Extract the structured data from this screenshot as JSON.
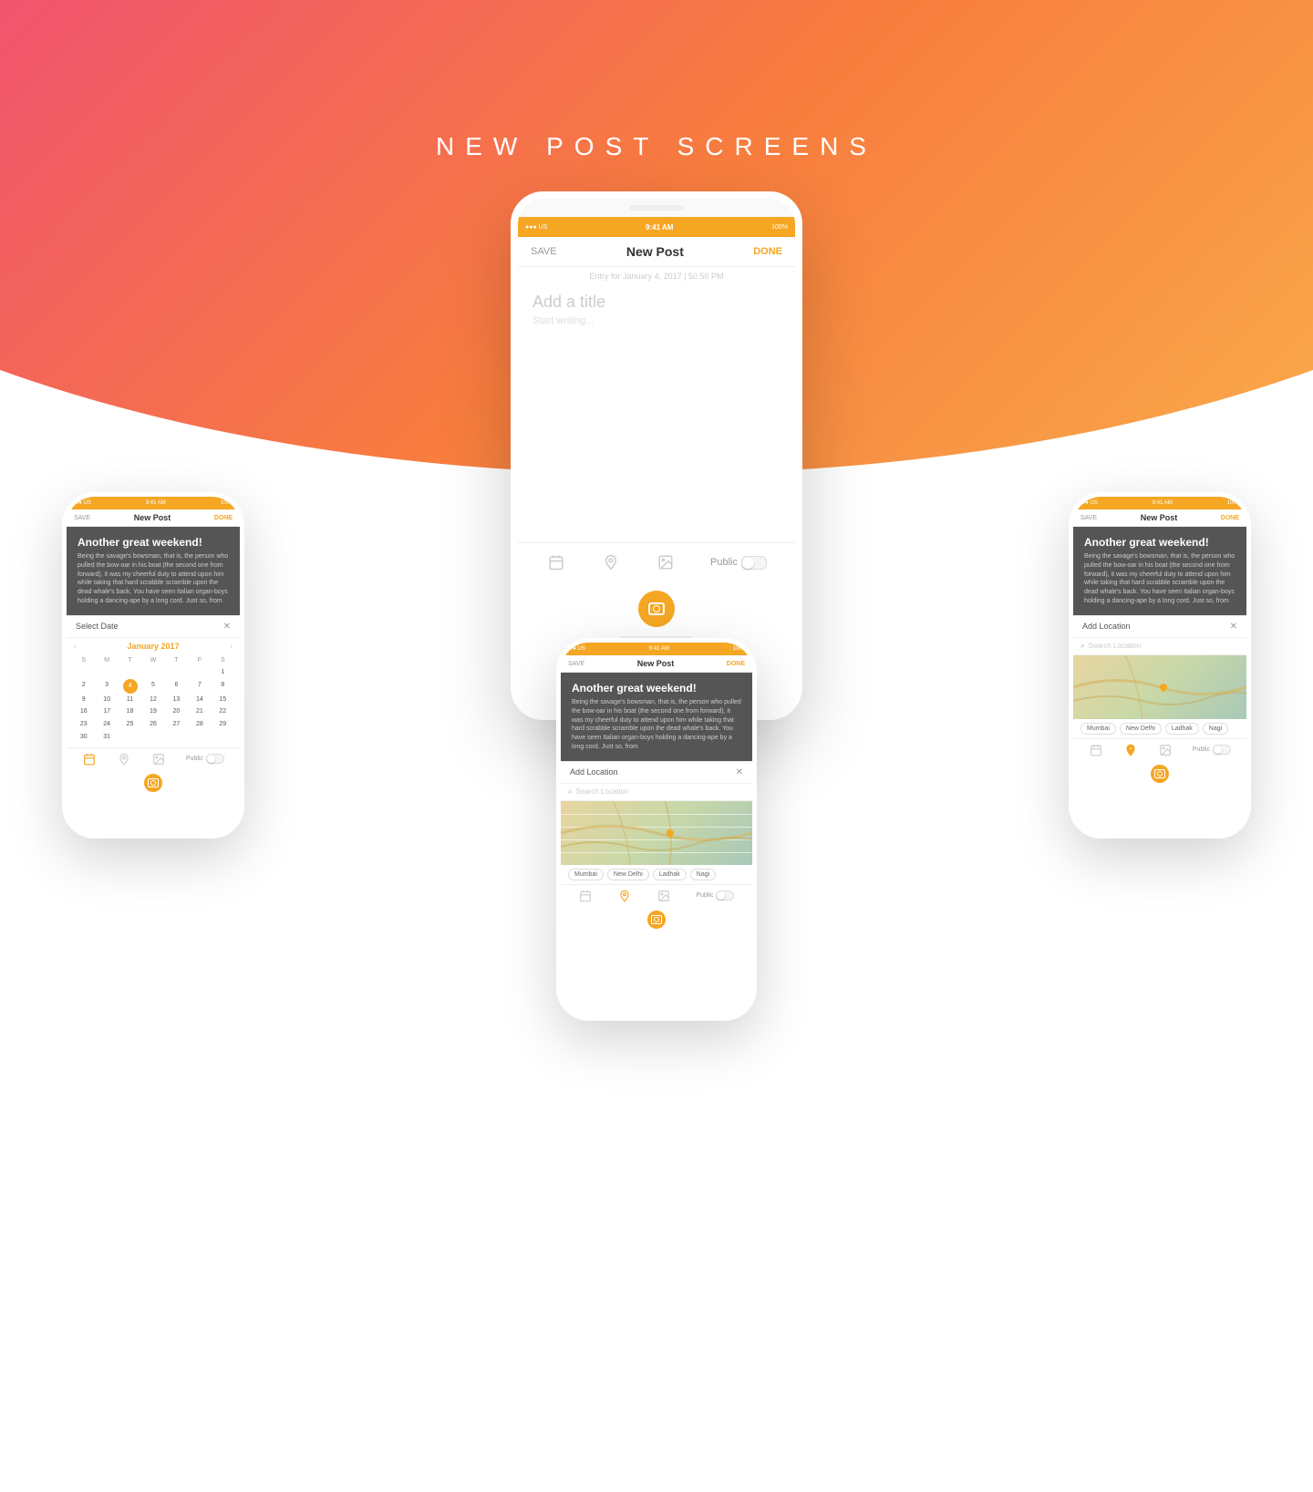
{
  "page": {
    "title": "NEW POST SCREENS",
    "background_gradient_start": "#f0546e",
    "background_gradient_end": "#f9a94a"
  },
  "phones": {
    "center_large": {
      "status": {
        "carrier": "●●● US",
        "wifi": "▾",
        "time": "9:41 AM",
        "battery": "100%"
      },
      "nav": {
        "save": "SAVE",
        "title": "New Post",
        "done": "DONE"
      },
      "entry_date": "Entry for January 4, 2017 | 50.50 PM",
      "content": {
        "title_placeholder": "Add a title",
        "body_placeholder": "Start writing..."
      },
      "toolbar": {
        "calendar_label": "calendar",
        "location_label": "location",
        "image_label": "image",
        "public_label": "Public"
      },
      "camera_hint": "+"
    },
    "left": {
      "status": {
        "carrier": "●●● US",
        "wifi": "▾",
        "time": "9:41 AM",
        "battery": "100%"
      },
      "nav": {
        "save": "SAVE",
        "title": "New Post",
        "done": "DONE"
      },
      "post_title": "Another great weekend!",
      "post_body": "Being the savage's bowsman, that is, the person who pulled the bow-oar in his boat (the second one from forward), it was my cheerful duty to attend upon him while taking that hard scrabble scramble upon the dead whale's back. You have seen Italian organ-boys holding a dancing-ape by a long cord. Just so, from",
      "calendar": {
        "header": "Select Date",
        "month": "January 2017",
        "weekdays": [
          "S",
          "M",
          "T",
          "W",
          "T",
          "F",
          "S"
        ],
        "days": [
          "",
          "",
          "",
          "",
          "",
          "",
          "1",
          "2",
          "3",
          "4",
          "5",
          "6",
          "7",
          "8",
          "9",
          "10",
          "11",
          "12",
          "13",
          "14",
          "15",
          "16",
          "17",
          "18",
          "19",
          "20",
          "21",
          "22",
          "23",
          "24",
          "25",
          "26",
          "27",
          "28",
          "29",
          "30",
          "31"
        ],
        "today": "4"
      },
      "toolbar": {
        "public_label": "Public"
      }
    },
    "center_bottom": {
      "status": {
        "carrier": "●●● US",
        "wifi": "▾",
        "time": "9:41 AM",
        "battery": "100%"
      },
      "nav": {
        "save": "SAVE",
        "title": "New Post",
        "done": "DONE"
      },
      "post_title": "Another great weekend!",
      "post_body": "Being the savage's bowsman, that is, the person who pulled the bow-oar in his boat (the second one from forward), it was my cheerful duty to attend upon him while taking that hard scrabble scramble upon the dead whale's back. You have seen Italian organ-boys holding a dancing-ape by a long cord. Just so, from",
      "location": {
        "header": "Add Location",
        "search_placeholder": "Search Location",
        "chips": [
          "Mumbai",
          "New Delhi",
          "Ladhak",
          "Nagi"
        ]
      },
      "toolbar": {
        "public_label": "Public"
      }
    },
    "right": {
      "status": {
        "carrier": "●●● US",
        "wifi": "▾",
        "time": "9:41 AM",
        "battery": "100%"
      },
      "nav": {
        "save": "SAVE",
        "title": "New Post",
        "done": "DONE"
      },
      "post_title": "Another great weekend!",
      "post_body": "Being the savage's bowsman, that is, the person who pulled the bow-oar in his boat (the second one from forward), it was my cheerful duty to attend upon him while taking that hard scrabble scramble upon the dead whale's back. You have seen Italian organ-boys holding a dancing-ape by a long cord. Just so, from",
      "location": {
        "header": "Add Location",
        "search_placeholder": "Search Location",
        "chips": [
          "Mumbai",
          "New Delhi",
          "Ladhak",
          "Nagi"
        ]
      },
      "toolbar": {
        "public_label": "Public"
      }
    }
  }
}
